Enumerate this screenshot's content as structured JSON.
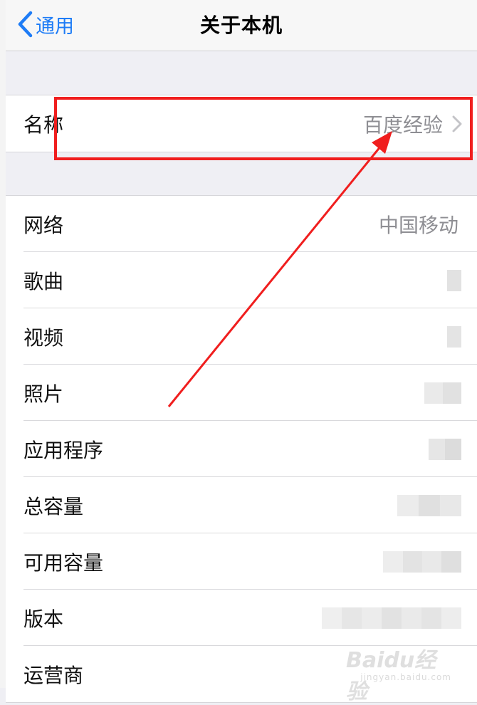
{
  "navbar": {
    "back_label": "通用",
    "title": "关于本机"
  },
  "name_row": {
    "label": "名称",
    "value": "百度经验"
  },
  "info_rows": [
    {
      "label": "网络",
      "value": "中国移动"
    },
    {
      "label": "歌曲",
      "value": ""
    },
    {
      "label": "视频",
      "value": ""
    },
    {
      "label": "照片",
      "value": ""
    },
    {
      "label": "应用程序",
      "value": ""
    },
    {
      "label": "总容量",
      "value": ""
    },
    {
      "label": "可用容量",
      "value": ""
    },
    {
      "label": "版本",
      "value": ""
    },
    {
      "label": "运营商",
      "value": ""
    }
  ],
  "watermark": {
    "logo": "Baidu经验",
    "url": "jingyan.baidu.com"
  },
  "colors": {
    "accent": "#1e7cf6",
    "highlight": "#f01e1e",
    "secondary_text": "#8e8e93",
    "background": "#efeff4"
  },
  "icons": {
    "back": "chevron-left-icon",
    "disclosure": "chevron-right-icon"
  }
}
